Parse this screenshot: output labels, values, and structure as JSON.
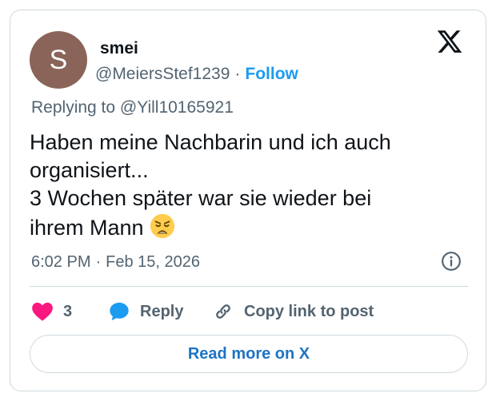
{
  "author": {
    "avatar_letter": "S",
    "avatar_color": "#8a6458",
    "name": "smei",
    "handle": "@MeiersStef1239",
    "separator": "·",
    "follow_label": "Follow"
  },
  "reply_context": {
    "prefix": "Replying to",
    "mention": "@Yill10165921"
  },
  "tweet": {
    "lines": [
      "Haben meine Nachbarin und ich auch",
      "organisiert...",
      "3 Wochen später war sie wieder bei",
      "ihrem Mann"
    ],
    "emoji": "weary-face"
  },
  "meta": {
    "time": "6:02 PM",
    "separator": "·",
    "date": "Feb 15, 2026"
  },
  "actions": {
    "like_count": "3",
    "reply_label": "Reply",
    "copy_label": "Copy link to post"
  },
  "read_more_label": "Read more on X",
  "colors": {
    "accent": "#1d9bf0",
    "like": "#f91880",
    "muted": "#536471",
    "border": "#cfd9de"
  },
  "icons": [
    "x-logo-icon",
    "info-icon",
    "heart-icon",
    "speech-bubble-icon",
    "link-icon"
  ]
}
